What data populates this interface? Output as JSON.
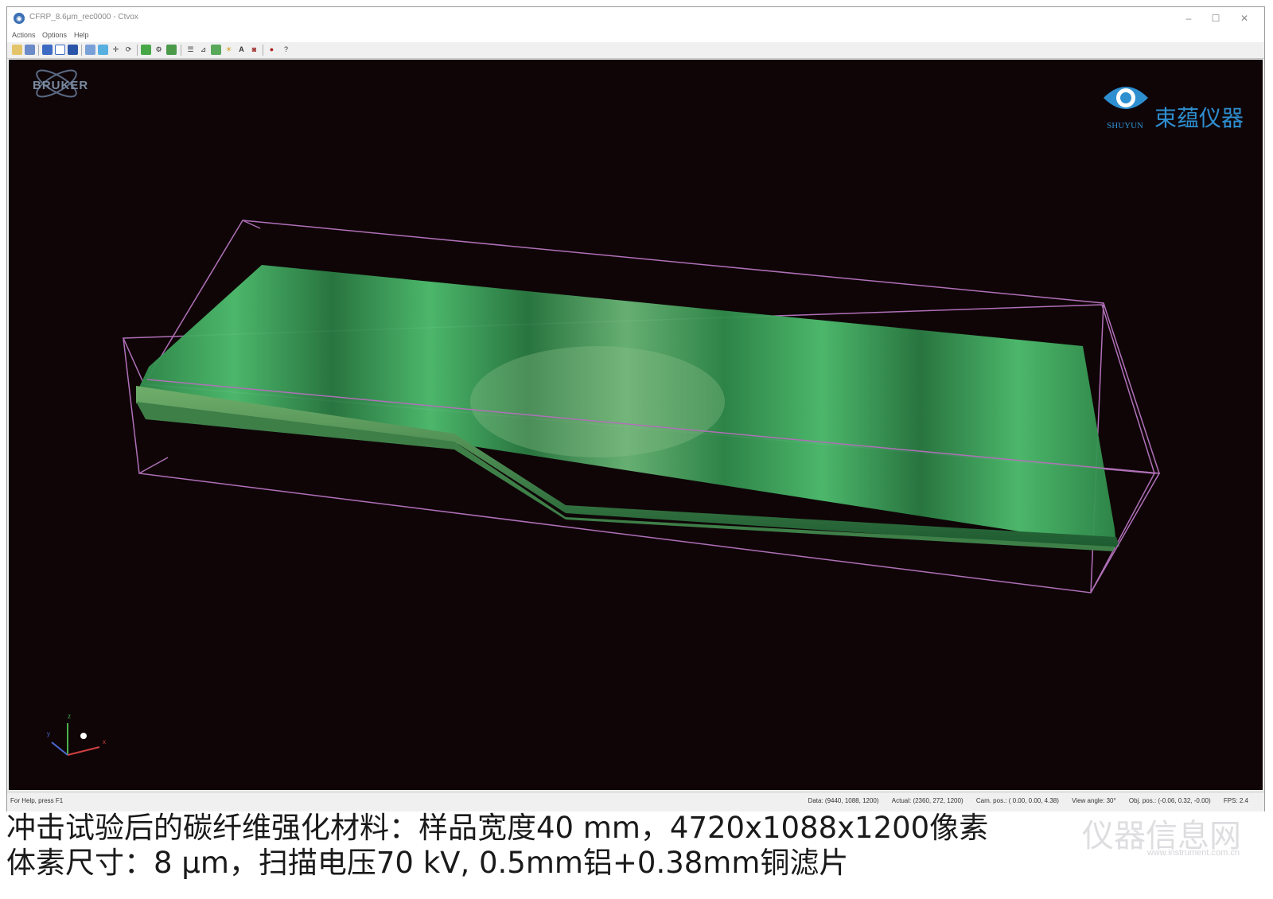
{
  "window": {
    "title": "CFRP_8.6μm_rec0000 - Ctvox",
    "app_icon": "ctvox-app-icon",
    "controls": [
      "–",
      "☐",
      "✕"
    ]
  },
  "menubar": [
    "Actions",
    "Options",
    "Help"
  ],
  "toolbar": {
    "icons": [
      "open-icon",
      "save-icon",
      "cube-front-icon",
      "cube-outline-icon",
      "cube-solid-icon",
      "eye-icon",
      "drop-icon",
      "move-icon",
      "rotate-icon",
      "clipping-box-icon",
      "gear-icon",
      "palette-icon",
      "list-icon",
      "chart-icon",
      "image-icon",
      "light-icon",
      "text-icon",
      "camera-icon",
      "record-icon",
      "help-icon"
    ]
  },
  "viewport": {
    "bruker_logo": "BRUKER",
    "shuyun_logo": {
      "name": "束蕴仪器",
      "sub": "SHUYUN"
    },
    "axes": {
      "x": "x",
      "y": "y",
      "z": "z"
    },
    "colors": {
      "background": "#0f0507",
      "sample": "#3aa85e",
      "bounding_box": "#b070b8"
    }
  },
  "statusbar": {
    "help": "For Help, press F1",
    "data": "Data: (9440, 1088, 1200)",
    "actual": "Actual: (2360, 272, 1200)",
    "cam_pos": "Cam. pos.: ( 0.00, 0.00, 4.38)",
    "view_angle": "View angle: 30°",
    "obj_pos": "Obj. pos.: (-0.06, 0.32, -0.00)",
    "fps": "FPS: 2.4"
  },
  "caption": {
    "line1": "冲击试验后的碳纤维强化材料：样品宽度40 mm，4720x1088x1200像素",
    "line2": "体素尺寸：8 μm，扫描电压70 kV, 0.5mm铝+0.38mm铜滤片"
  },
  "watermark": {
    "text": "仪器信息网",
    "sub": "www.instrument.com.cn"
  }
}
